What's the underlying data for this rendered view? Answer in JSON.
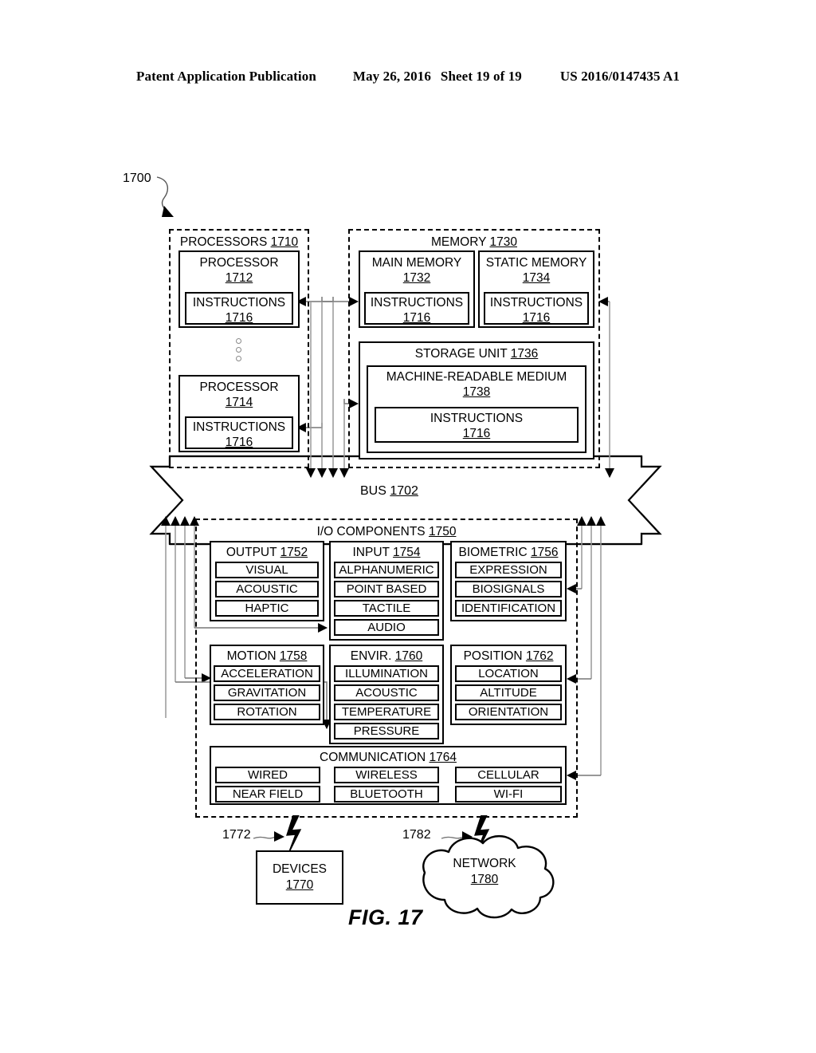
{
  "header": {
    "publication": "Patent Application Publication",
    "date": "May 26, 2016",
    "sheet": "Sheet 19 of 19",
    "patent_number": "US 2016/0147435 A1"
  },
  "figure": {
    "caption": "FIG. 17",
    "system_ref": "1700"
  },
  "processors": {
    "title": "PROCESSORS",
    "ref": "1710",
    "items": [
      {
        "title": "PROCESSOR",
        "ref": "1712",
        "inner": {
          "title": "INSTRUCTIONS",
          "ref": "1716"
        }
      },
      {
        "title": "PROCESSOR",
        "ref": "1714",
        "inner": {
          "title": "INSTRUCTIONS",
          "ref": "1716"
        }
      }
    ],
    "ellipsis": "vertical-dots"
  },
  "memory": {
    "title": "MEMORY",
    "ref": "1730",
    "main_memory": {
      "title": "MAIN MEMORY",
      "ref": "1732",
      "inner": {
        "title": "INSTRUCTIONS",
        "ref": "1716"
      }
    },
    "static_memory": {
      "title": "STATIC MEMORY",
      "ref": "1734",
      "inner": {
        "title": "INSTRUCTIONS",
        "ref": "1716"
      }
    },
    "storage_unit": {
      "title": "STORAGE UNIT",
      "ref": "1736",
      "medium": {
        "title": "MACHINE-READABLE MEDIUM",
        "ref": "1738",
        "inner": {
          "title": "INSTRUCTIONS",
          "ref": "1716"
        }
      }
    }
  },
  "bus": {
    "label": "BUS",
    "ref": "1702"
  },
  "io_components": {
    "title": "I/O COMPONENTS",
    "ref": "1750",
    "groups": [
      {
        "title": "OUTPUT",
        "ref": "1752",
        "items": [
          "VISUAL",
          "ACOUSTIC",
          "HAPTIC"
        ]
      },
      {
        "title": "INPUT",
        "ref": "1754",
        "items": [
          "ALPHANUMERIC",
          "POINT BASED",
          "TACTILE",
          "AUDIO"
        ]
      },
      {
        "title": "BIOMETRIC",
        "ref": "1756",
        "items": [
          "EXPRESSION",
          "BIOSIGNALS",
          "IDENTIFICATION"
        ]
      },
      {
        "title": "MOTION",
        "ref": "1758",
        "items": [
          "ACCELERATION",
          "GRAVITATION",
          "ROTATION"
        ]
      },
      {
        "title": "ENVIR.",
        "ref": "1760",
        "items": [
          "ILLUMINATION",
          "ACOUSTIC",
          "TEMPERATURE",
          "PRESSURE"
        ]
      },
      {
        "title": "POSITION",
        "ref": "1762",
        "items": [
          "LOCATION",
          "ALTITUDE",
          "ORIENTATION"
        ]
      }
    ],
    "communication": {
      "title": "COMMUNICATION",
      "ref": "1764",
      "row1": [
        "WIRED",
        "WIRELESS",
        "CELLULAR"
      ],
      "row2": [
        "NEAR FIELD",
        "BLUETOOTH",
        "WI-FI"
      ]
    }
  },
  "endpoints": {
    "devices": {
      "title": "DEVICES",
      "ref": "1770",
      "link_ref": "1772"
    },
    "network": {
      "title": "NETWORK",
      "ref": "1780",
      "link_ref": "1782"
    }
  }
}
